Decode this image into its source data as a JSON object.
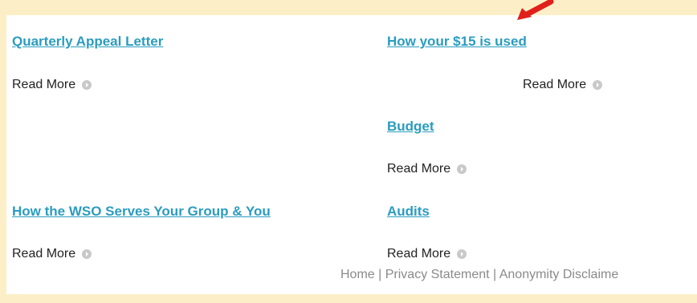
{
  "articles": [
    {
      "title": "Quarterly Appeal Letter",
      "read_more": "Read More"
    },
    {
      "title": "How your $15 is used",
      "read_more": "Read More"
    },
    {
      "title": "Budget",
      "read_more": "Read More"
    },
    {
      "title": "How the WSO Serves Your Group & You",
      "read_more": "Read More"
    },
    {
      "title": "Audits",
      "read_more": "Read More"
    }
  ],
  "footer": {
    "home": "Home",
    "separator": " | ",
    "privacy": "Privacy Statement",
    "anonymity": "Anonymity Disclaime"
  },
  "colors": {
    "link": "#2a9cbf",
    "background": "#fcefc7",
    "arrow": "#e0201b"
  },
  "icons": {
    "read_more_icon": "grey-circle-play-icon",
    "annotation": "red-arrow-icon"
  }
}
